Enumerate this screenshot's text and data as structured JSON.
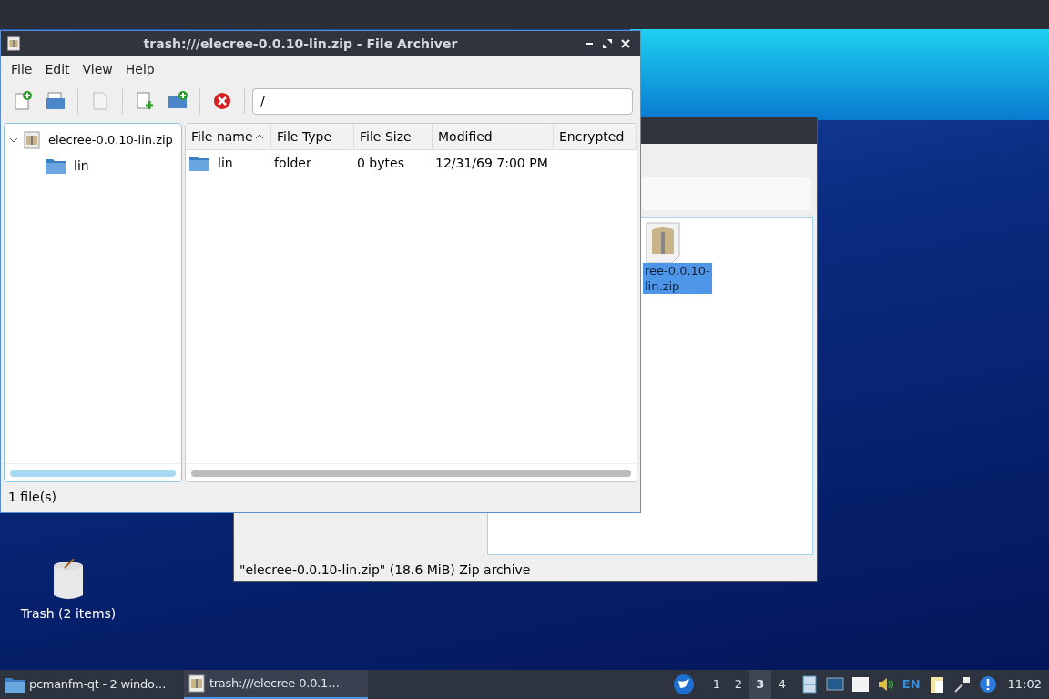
{
  "desktop": {
    "icons": [
      {
        "label": "Trash (2 items)"
      }
    ]
  },
  "back_window": {
    "file": {
      "lines": [
        "ree-0.0.10-",
        "lin.zip"
      ],
      "selected": true
    },
    "status_bar": "\"elecree-0.0.10-lin.zip\" (18.6 MiB) Zip archive"
  },
  "window": {
    "title": "trash:///elecree-0.0.10-lin.zip - File Archiver",
    "menu": [
      "File",
      "Edit",
      "View",
      "Help"
    ],
    "path": "/",
    "tree": [
      {
        "label": "elecree-0.0.10-lin.zip",
        "expanded": true,
        "children": [
          {
            "label": "lin"
          }
        ]
      }
    ],
    "table": {
      "columns": [
        {
          "label": "File name",
          "sorted": true
        },
        {
          "label": "File Type",
          "sorted": false
        },
        {
          "label": "File Size",
          "sorted": false
        },
        {
          "label": "Modified",
          "sorted": false
        },
        {
          "label": "Encrypted",
          "sorted": false
        }
      ],
      "rows": [
        {
          "cells": [
            "lin",
            "folder",
            "0 bytes",
            "12/31/69 7:00 PM"
          ]
        }
      ]
    },
    "status_bar": "1 file(s)"
  },
  "taskbar": {
    "tasks": [
      {
        "label": "pcmanfm-qt - 2 windo…",
        "selected": false
      },
      {
        "label": "trash:///elecree-0.0.1…",
        "selected": true
      }
    ],
    "workspaces": [
      {
        "label": "1",
        "selected": false
      },
      {
        "label": "2",
        "selected": false
      },
      {
        "label": "3",
        "selected": true
      },
      {
        "label": "4",
        "selected": false
      }
    ],
    "language": "EN",
    "clock": "11:02"
  }
}
